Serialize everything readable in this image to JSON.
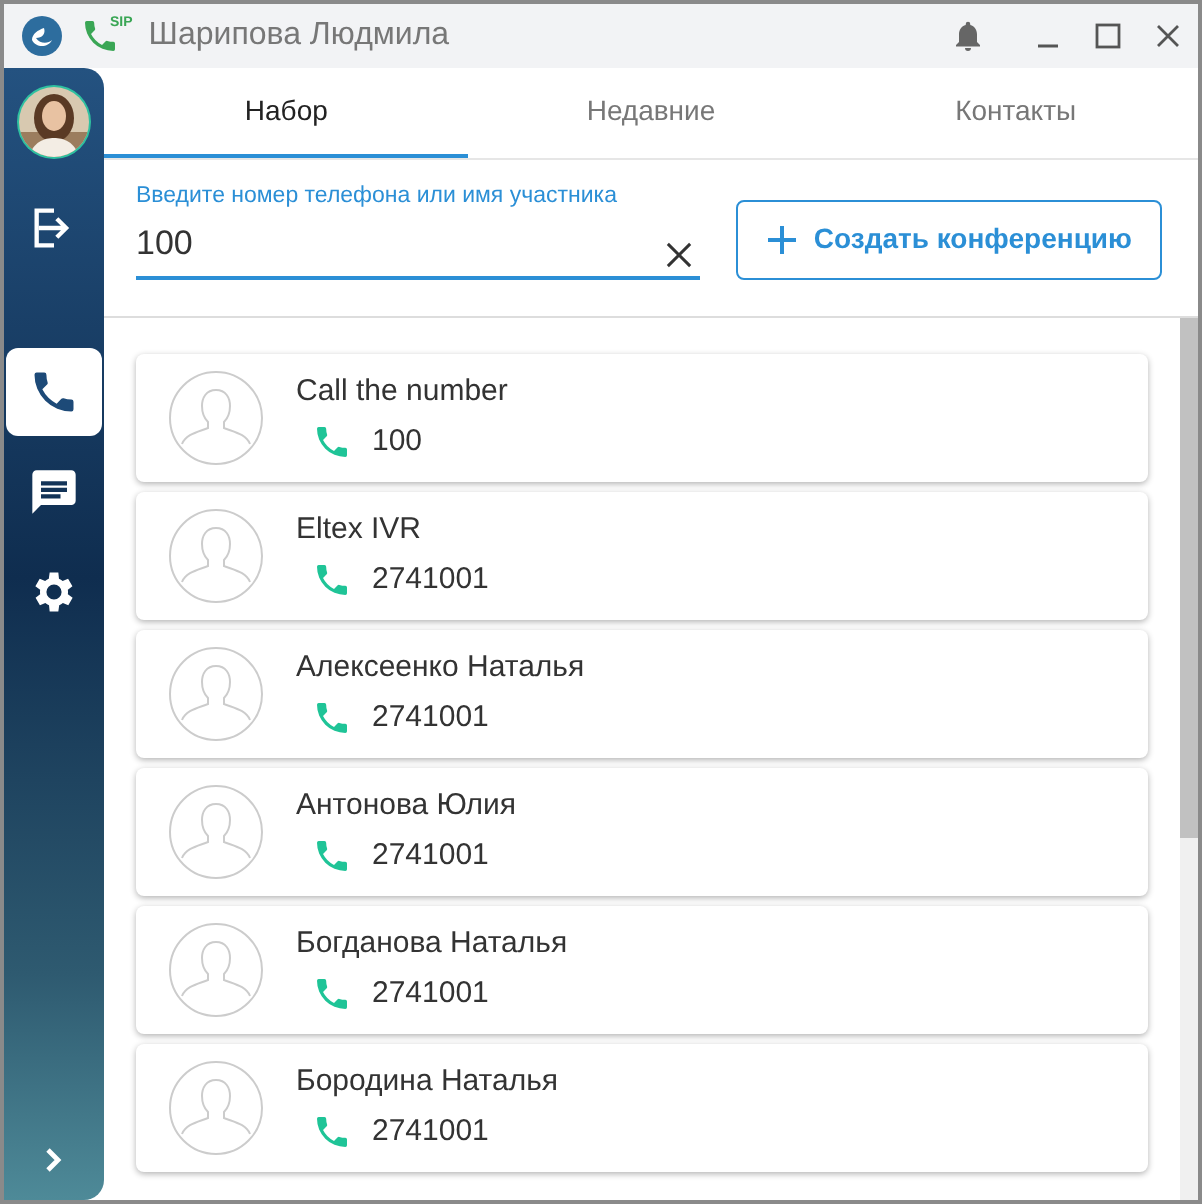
{
  "window": {
    "title": "Шарипова Людмила",
    "badge": "SIP"
  },
  "sidebar": {
    "items": [
      {
        "kind": "logout",
        "selected": false
      },
      {
        "kind": "phone",
        "selected": true
      },
      {
        "kind": "chat",
        "selected": false
      },
      {
        "kind": "settings",
        "selected": false
      }
    ]
  },
  "tabs": [
    {
      "label": "Набор",
      "selected": true
    },
    {
      "label": "Недавние",
      "selected": false
    },
    {
      "label": "Контакты",
      "selected": false
    }
  ],
  "search": {
    "label": "Введите номер телефона или имя участника",
    "value": "100"
  },
  "conference_button": {
    "label": "Создать конференцию"
  },
  "contacts": [
    {
      "name": "Call the number",
      "number": "100"
    },
    {
      "name": "Eltex IVR",
      "number": "2741001"
    },
    {
      "name": "Алексеенко Наталья",
      "number": "2741001"
    },
    {
      "name": "Антонова Юлия",
      "number": "2741001"
    },
    {
      "name": "Богданова Наталья",
      "number": "2741001"
    },
    {
      "name": "Бородина Наталья",
      "number": "2741001"
    }
  ]
}
